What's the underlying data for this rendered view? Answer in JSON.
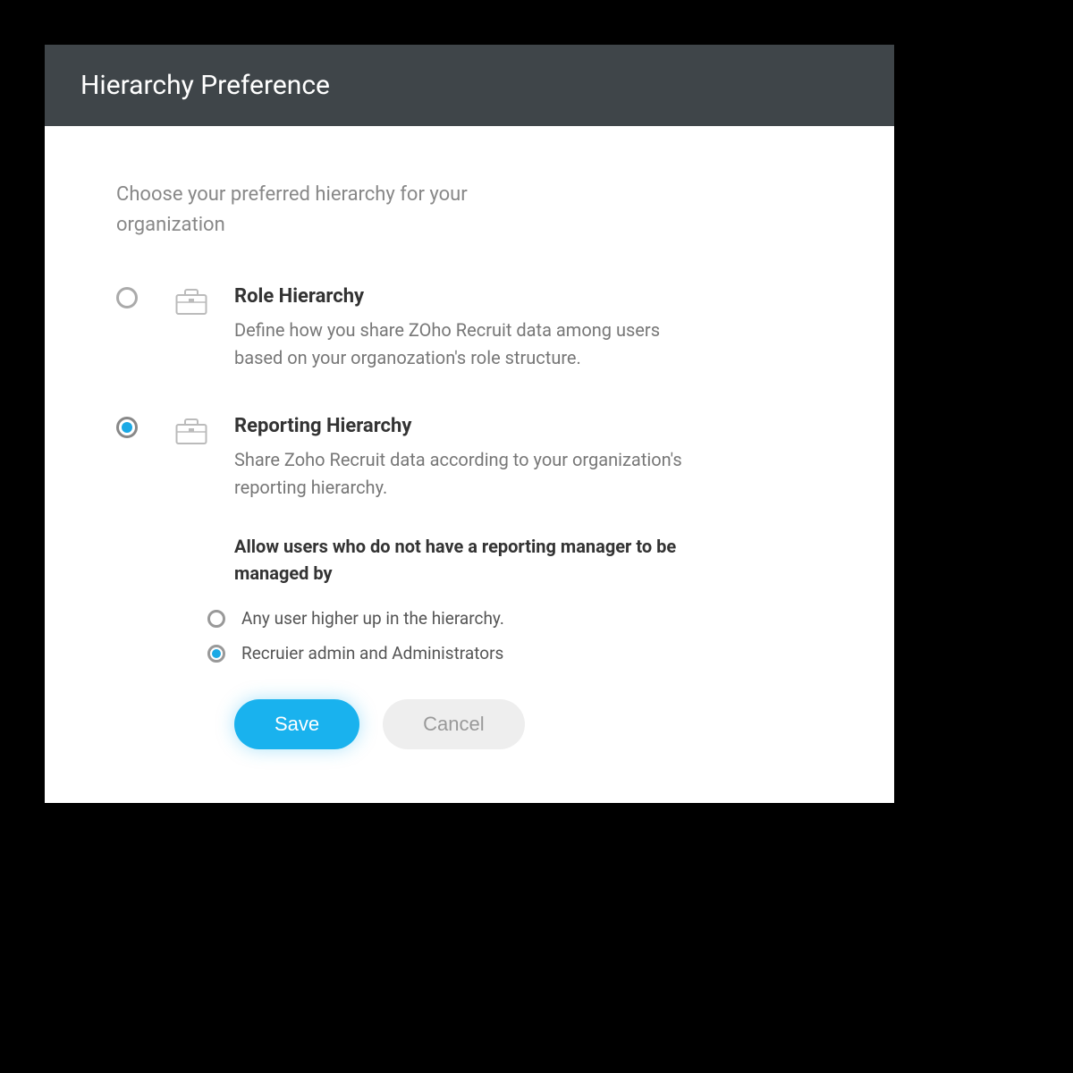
{
  "header": {
    "title": "Hierarchy Preference"
  },
  "intro": "Choose your preferred hierarchy for your organization",
  "options": [
    {
      "title": "Role Hierarchy",
      "description": "Define how you share ZOho Recruit data among users based on your organozation's role structure.",
      "selected": false
    },
    {
      "title": "Reporting Hierarchy",
      "description": "Share Zoho Recruit data according to your organization's reporting hierarchy.",
      "selected": true,
      "sub_heading": "Allow users who do not have a reporting manager to be managed by",
      "sub_options": [
        {
          "label": "Any user higher up in the hierarchy.",
          "selected": false
        },
        {
          "label": "Recruier admin and Administrators",
          "selected": true
        }
      ]
    }
  ],
  "buttons": {
    "save": "Save",
    "cancel": "Cancel"
  },
  "colors": {
    "accent": "#19b2ee",
    "header_bg": "#3f4549"
  }
}
